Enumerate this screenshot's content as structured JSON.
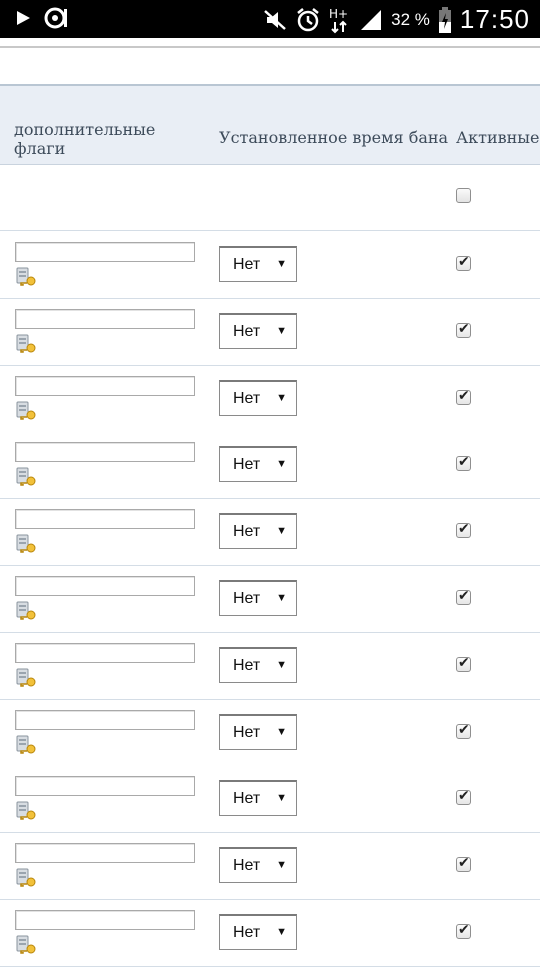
{
  "status_bar": {
    "battery_percent": "32 %",
    "clock": "17:50",
    "network": "H+",
    "icons": [
      "play-icon",
      "voicemail-icon",
      "mute-icon",
      "alarm-icon",
      "network-type-icon",
      "signal-icon",
      "battery-charging-icon"
    ]
  },
  "table": {
    "headers": {
      "flags": "дополнительные флаги",
      "ban_time": "Установленное время бана",
      "active": "Активные"
    },
    "empty_row": {
      "active_checked": false
    },
    "select_default": "Нет",
    "rows": [
      {
        "flags": "",
        "ban_time": "Нет",
        "active": true
      },
      {
        "flags": "",
        "ban_time": "Нет",
        "active": true
      },
      {
        "flags": "",
        "ban_time": "Нет",
        "active": true
      },
      {
        "flags": "",
        "ban_time": "Нет",
        "active": true
      },
      {
        "flags": "",
        "ban_time": "Нет",
        "active": true
      },
      {
        "flags": "",
        "ban_time": "Нет",
        "active": true
      },
      {
        "flags": "",
        "ban_time": "Нет",
        "active": true
      },
      {
        "flags": "",
        "ban_time": "Нет",
        "active": true
      },
      {
        "flags": "",
        "ban_time": "Нет",
        "active": true
      },
      {
        "flags": "",
        "ban_time": "Нет",
        "active": true
      },
      {
        "flags": "",
        "ban_time": "Нет",
        "active": true
      }
    ]
  }
}
